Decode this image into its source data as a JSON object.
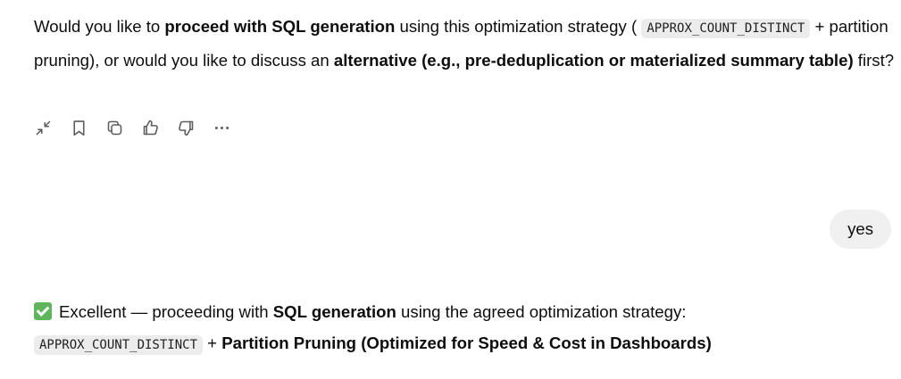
{
  "assistant_message_1": {
    "t1": "Would you like to ",
    "b1": "proceed with SQL generation",
    "t2": " using this optimization strategy ( ",
    "code1": "APPROX_COUNT_DISTINCT",
    "t3": " + partition pruning), or would you like to discuss an ",
    "b2": "alternative (e.g., pre-deduplication or materialized summary table)",
    "t4": " first?"
  },
  "message_actions": {
    "icons": [
      "collapse-icon",
      "bookmark-icon",
      "copy-icon",
      "thumbs-up-icon",
      "thumbs-down-icon",
      "more-icon"
    ]
  },
  "user_message": {
    "text": "yes"
  },
  "assistant_message_2": {
    "emoji": "check-mark-emoji",
    "t1": "Excellent — proceeding with ",
    "b1": "SQL generation",
    "t2": " using the agreed optimization strategy:",
    "code1": "APPROX_COUNT_DISTINCT",
    "t3": " + ",
    "b2": "Partition Pruning (Optimized for Speed & Cost in Dashboards)"
  }
}
